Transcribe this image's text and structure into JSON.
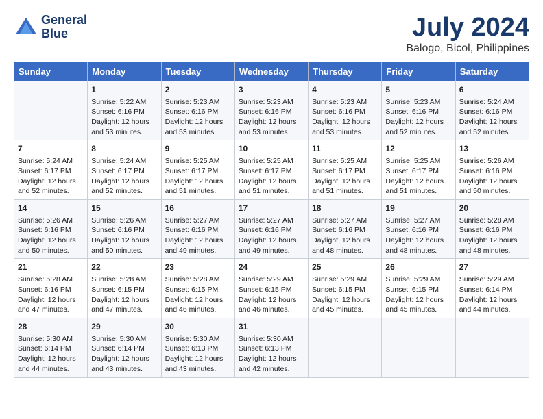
{
  "header": {
    "logo_line1": "General",
    "logo_line2": "Blue",
    "title": "July 2024",
    "subtitle": "Balogo, Bicol, Philippines"
  },
  "columns": [
    "Sunday",
    "Monday",
    "Tuesday",
    "Wednesday",
    "Thursday",
    "Friday",
    "Saturday"
  ],
  "weeks": [
    [
      {
        "day": "",
        "info": ""
      },
      {
        "day": "1",
        "info": "Sunrise: 5:22 AM\nSunset: 6:16 PM\nDaylight: 12 hours\nand 53 minutes."
      },
      {
        "day": "2",
        "info": "Sunrise: 5:23 AM\nSunset: 6:16 PM\nDaylight: 12 hours\nand 53 minutes."
      },
      {
        "day": "3",
        "info": "Sunrise: 5:23 AM\nSunset: 6:16 PM\nDaylight: 12 hours\nand 53 minutes."
      },
      {
        "day": "4",
        "info": "Sunrise: 5:23 AM\nSunset: 6:16 PM\nDaylight: 12 hours\nand 53 minutes."
      },
      {
        "day": "5",
        "info": "Sunrise: 5:23 AM\nSunset: 6:16 PM\nDaylight: 12 hours\nand 52 minutes."
      },
      {
        "day": "6",
        "info": "Sunrise: 5:24 AM\nSunset: 6:16 PM\nDaylight: 12 hours\nand 52 minutes."
      }
    ],
    [
      {
        "day": "7",
        "info": "Sunrise: 5:24 AM\nSunset: 6:17 PM\nDaylight: 12 hours\nand 52 minutes."
      },
      {
        "day": "8",
        "info": "Sunrise: 5:24 AM\nSunset: 6:17 PM\nDaylight: 12 hours\nand 52 minutes."
      },
      {
        "day": "9",
        "info": "Sunrise: 5:25 AM\nSunset: 6:17 PM\nDaylight: 12 hours\nand 51 minutes."
      },
      {
        "day": "10",
        "info": "Sunrise: 5:25 AM\nSunset: 6:17 PM\nDaylight: 12 hours\nand 51 minutes."
      },
      {
        "day": "11",
        "info": "Sunrise: 5:25 AM\nSunset: 6:17 PM\nDaylight: 12 hours\nand 51 minutes."
      },
      {
        "day": "12",
        "info": "Sunrise: 5:25 AM\nSunset: 6:17 PM\nDaylight: 12 hours\nand 51 minutes."
      },
      {
        "day": "13",
        "info": "Sunrise: 5:26 AM\nSunset: 6:16 PM\nDaylight: 12 hours\nand 50 minutes."
      }
    ],
    [
      {
        "day": "14",
        "info": "Sunrise: 5:26 AM\nSunset: 6:16 PM\nDaylight: 12 hours\nand 50 minutes."
      },
      {
        "day": "15",
        "info": "Sunrise: 5:26 AM\nSunset: 6:16 PM\nDaylight: 12 hours\nand 50 minutes."
      },
      {
        "day": "16",
        "info": "Sunrise: 5:27 AM\nSunset: 6:16 PM\nDaylight: 12 hours\nand 49 minutes."
      },
      {
        "day": "17",
        "info": "Sunrise: 5:27 AM\nSunset: 6:16 PM\nDaylight: 12 hours\nand 49 minutes."
      },
      {
        "day": "18",
        "info": "Sunrise: 5:27 AM\nSunset: 6:16 PM\nDaylight: 12 hours\nand 48 minutes."
      },
      {
        "day": "19",
        "info": "Sunrise: 5:27 AM\nSunset: 6:16 PM\nDaylight: 12 hours\nand 48 minutes."
      },
      {
        "day": "20",
        "info": "Sunrise: 5:28 AM\nSunset: 6:16 PM\nDaylight: 12 hours\nand 48 minutes."
      }
    ],
    [
      {
        "day": "21",
        "info": "Sunrise: 5:28 AM\nSunset: 6:16 PM\nDaylight: 12 hours\nand 47 minutes."
      },
      {
        "day": "22",
        "info": "Sunrise: 5:28 AM\nSunset: 6:15 PM\nDaylight: 12 hours\nand 47 minutes."
      },
      {
        "day": "23",
        "info": "Sunrise: 5:28 AM\nSunset: 6:15 PM\nDaylight: 12 hours\nand 46 minutes."
      },
      {
        "day": "24",
        "info": "Sunrise: 5:29 AM\nSunset: 6:15 PM\nDaylight: 12 hours\nand 46 minutes."
      },
      {
        "day": "25",
        "info": "Sunrise: 5:29 AM\nSunset: 6:15 PM\nDaylight: 12 hours\nand 45 minutes."
      },
      {
        "day": "26",
        "info": "Sunrise: 5:29 AM\nSunset: 6:15 PM\nDaylight: 12 hours\nand 45 minutes."
      },
      {
        "day": "27",
        "info": "Sunrise: 5:29 AM\nSunset: 6:14 PM\nDaylight: 12 hours\nand 44 minutes."
      }
    ],
    [
      {
        "day": "28",
        "info": "Sunrise: 5:30 AM\nSunset: 6:14 PM\nDaylight: 12 hours\nand 44 minutes."
      },
      {
        "day": "29",
        "info": "Sunrise: 5:30 AM\nSunset: 6:14 PM\nDaylight: 12 hours\nand 43 minutes."
      },
      {
        "day": "30",
        "info": "Sunrise: 5:30 AM\nSunset: 6:13 PM\nDaylight: 12 hours\nand 43 minutes."
      },
      {
        "day": "31",
        "info": "Sunrise: 5:30 AM\nSunset: 6:13 PM\nDaylight: 12 hours\nand 42 minutes."
      },
      {
        "day": "",
        "info": ""
      },
      {
        "day": "",
        "info": ""
      },
      {
        "day": "",
        "info": ""
      }
    ]
  ]
}
